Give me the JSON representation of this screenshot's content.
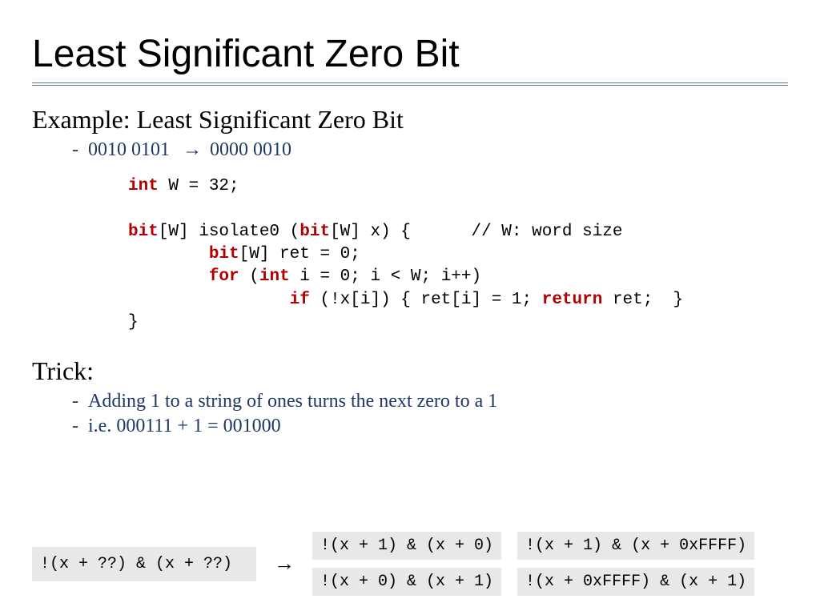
{
  "title": "Least Significant Zero Bit",
  "example": {
    "heading": "Example: Least Significant Zero Bit",
    "input": "0010 0101",
    "arrow": "→",
    "output": "0000 0010"
  },
  "code": {
    "l1_kw": "int",
    "l1_rest": " W = 32;",
    "l2_kw1": "bit",
    "l2_mid": "[W] isolate0 (",
    "l2_kw2": "bit",
    "l2_rest": "[W] x) {      // W: word size",
    "l3_pad": "        ",
    "l3_kw": "bit",
    "l3_rest": "[W] ret = 0;",
    "l4_pad": "        ",
    "l4_kw1": "for",
    "l4_mid": " (",
    "l4_kw2": "int",
    "l4_rest": " i = 0; i < W; i++)",
    "l5_pad": "                ",
    "l5_kw1": "if",
    "l5_mid": " (!x[i]) { ret[i] = 1; ",
    "l5_kw2": "return",
    "l5_rest": " ret;  }",
    "l6": "}"
  },
  "trick": {
    "heading": "Trick:",
    "bullet1": "Adding 1 to a string of ones turns the next zero to a 1",
    "bullet2": "i.e. 000111 + 1 = 001000"
  },
  "bottom": {
    "question": "!(x + ??) & (x + ??)",
    "arrow": "→",
    "opt1": "!(x + 1) & (x + 0)",
    "opt2": "!(x + 1) & (x + 0xFFFF)",
    "opt3": "!(x + 0) & (x + 1)",
    "opt4": "!(x + 0xFFFF) & (x + 1)"
  }
}
